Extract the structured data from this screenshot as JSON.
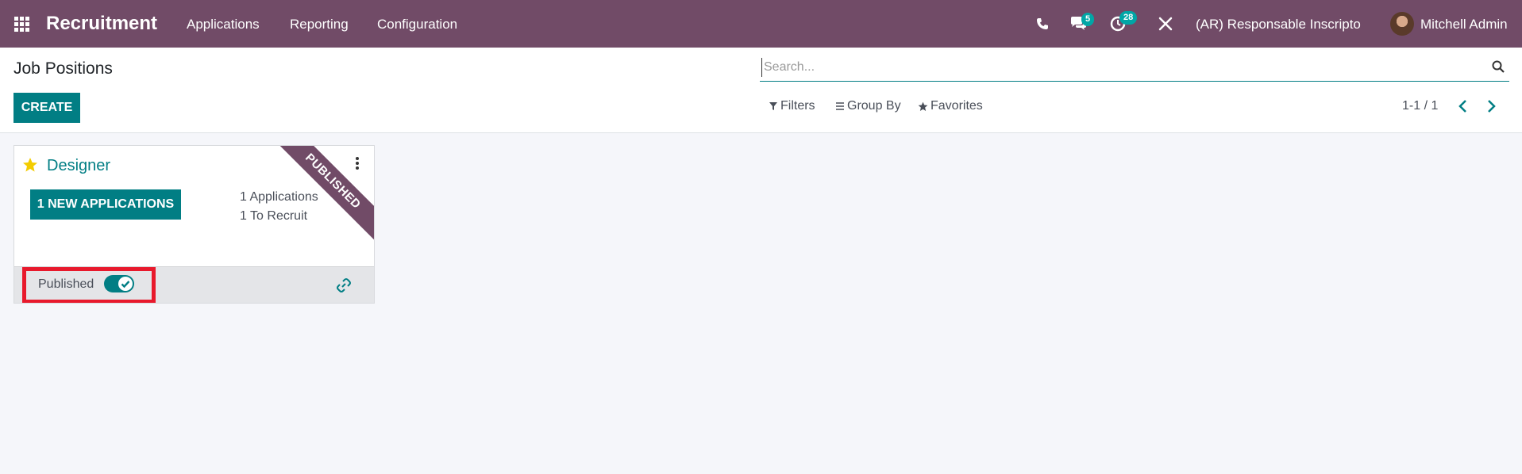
{
  "navbar": {
    "app_name": "Recruitment",
    "menus": [
      "Applications",
      "Reporting",
      "Configuration"
    ],
    "messages_count": "5",
    "activities_count": "28",
    "company": "(AR) Responsable Inscripto",
    "user": "Mitchell Admin",
    "bg_color": "#714b67"
  },
  "control_panel": {
    "title": "Job Positions",
    "create_label": "CREATE",
    "search_placeholder": "Search...",
    "filters_label": "Filters",
    "group_by_label": "Group By",
    "favorites_label": "Favorites",
    "pager": "1-1 / 1"
  },
  "card": {
    "job_name": "Designer",
    "ribbon": "PUBLISHED",
    "new_applications_label": "1 NEW APPLICATIONS",
    "applications": "1 Applications",
    "to_recruit": "1 To Recruit",
    "published_label": "Published",
    "published": true
  },
  "colors": {
    "primary": "#017e84",
    "accent": "#714b67",
    "highlight": "#e8192c",
    "star": "#f3cc00"
  }
}
